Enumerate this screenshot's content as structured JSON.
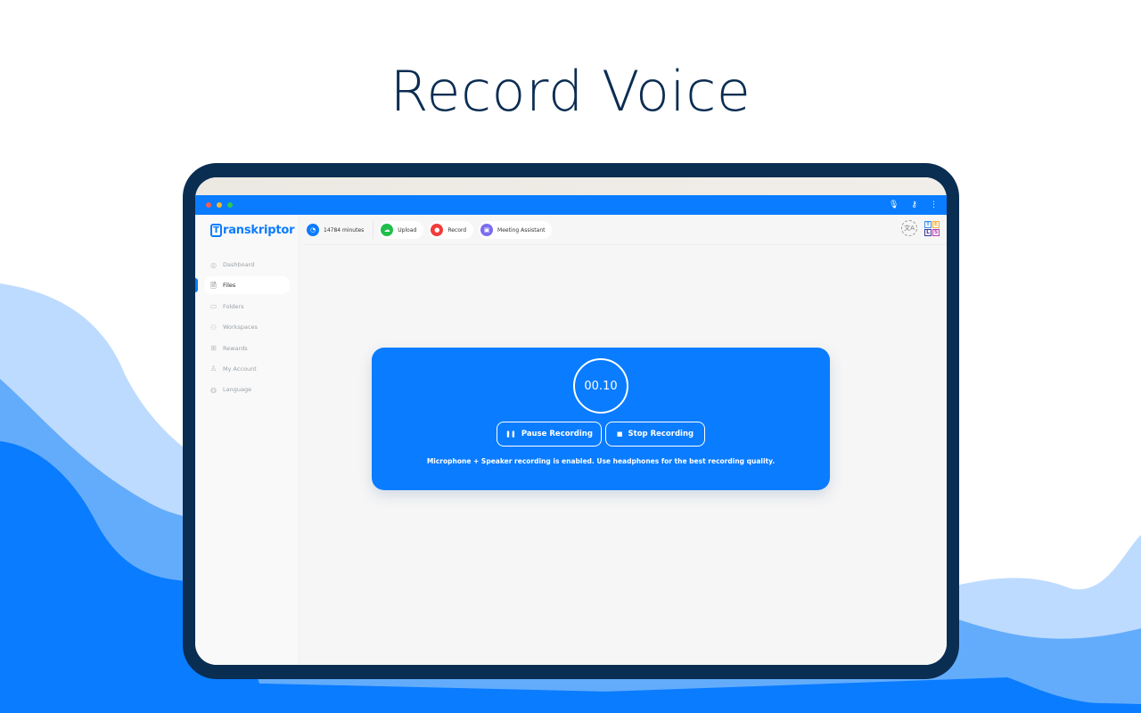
{
  "headline": "Record Voice",
  "colors": {
    "brand_blue": "#0a7cff",
    "navy": "#0a2d52",
    "wave_light": "#bddbff",
    "wave_mid": "#63acfc",
    "wave_dark": "#0a7cff"
  },
  "browser": {
    "window_controls": [
      "close",
      "minimize",
      "maximize"
    ],
    "toolbar_icons": [
      {
        "name": "microphone-icon",
        "glyph": "🎙"
      },
      {
        "name": "key-icon",
        "glyph": "⚷"
      },
      {
        "name": "more-vertical-icon",
        "glyph": "⋮"
      }
    ]
  },
  "app": {
    "logo_letter": "T",
    "logo_text": "ranskriptor",
    "sidebar": {
      "items": [
        {
          "label": "Dashboard",
          "icon": "dashboard-icon",
          "glyph": "◎",
          "active": false
        },
        {
          "label": "Files",
          "icon": "file-icon",
          "glyph": "🗎",
          "active": true
        },
        {
          "label": "Folders",
          "icon": "folder-icon",
          "glyph": "▭",
          "active": false
        },
        {
          "label": "Workspaces",
          "icon": "users-icon",
          "glyph": "⚇",
          "active": false
        },
        {
          "label": "Rewards",
          "icon": "gift-icon",
          "glyph": "⊞",
          "active": false
        },
        {
          "label": "My Account",
          "icon": "user-icon",
          "glyph": "♙",
          "active": false
        },
        {
          "label": "Language",
          "icon": "language-icon",
          "glyph": "◍",
          "active": false
        }
      ]
    },
    "toolbar": {
      "minutes": {
        "label": "14784 minutes",
        "icon": "clock-icon",
        "glyph": "◔",
        "color": "#0a7cff"
      },
      "upload": {
        "label": "Upload",
        "icon": "cloud-upload-icon",
        "glyph": "☁",
        "color": "#1fbf4a"
      },
      "record": {
        "label": "Record",
        "icon": "microphone-icon",
        "glyph": "●",
        "color": "#f23b3b"
      },
      "meeting": {
        "label": "Meeting Assistant",
        "icon": "robot-icon",
        "glyph": "▣",
        "color": "#7a6cf0"
      },
      "language_switch_glyph": "文A",
      "tls": [
        {
          "letter": "T",
          "color": "#3a8ef6"
        },
        {
          "letter": "E",
          "color": "#f4b23a"
        },
        {
          "letter": "L",
          "color": "#3b3b9a"
        },
        {
          "letter": "S",
          "color": "#b43fb4"
        }
      ]
    },
    "recorder": {
      "timer": "00.10",
      "pause_label": "Pause Recording",
      "pause_glyph": "❚❚",
      "stop_label": "Stop Recording",
      "stop_glyph": "■",
      "note": "Microphone + Speaker recording is enabled. Use headphones for the best recording quality."
    }
  }
}
